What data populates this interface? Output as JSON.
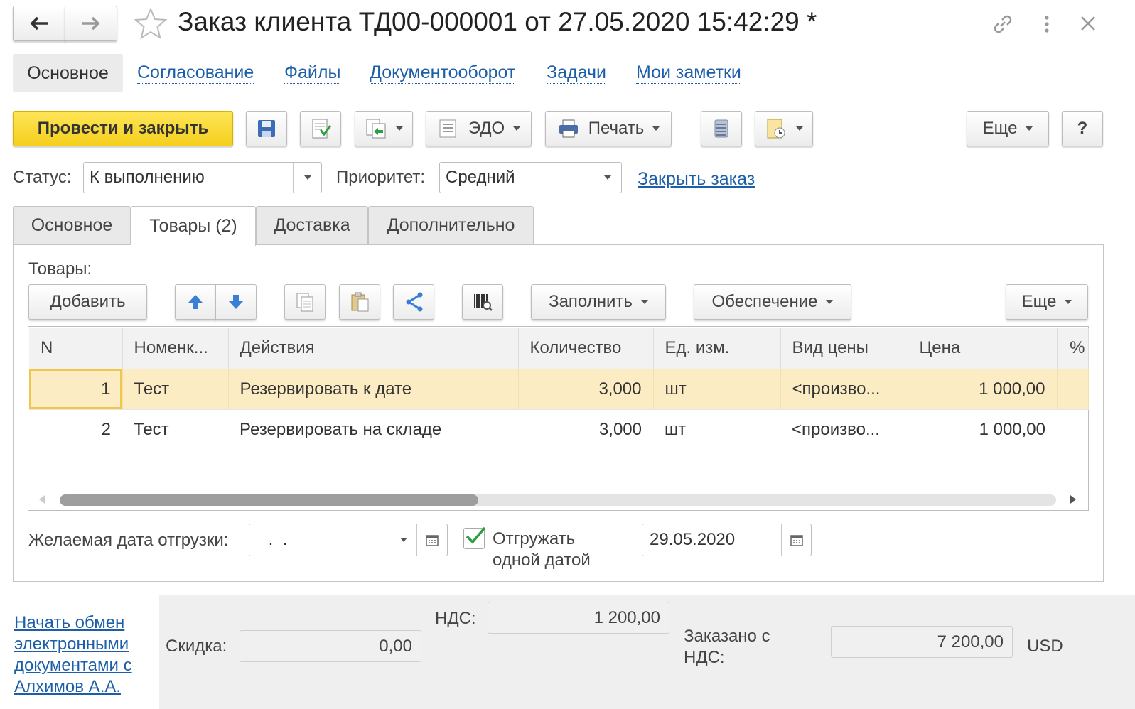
{
  "window": {
    "title": "Заказ клиента ТД00-000001 от 27.05.2020 15:42:29 *"
  },
  "nav": {
    "items": [
      {
        "label": "Основное"
      },
      {
        "label": "Согласование"
      },
      {
        "label": "Файлы"
      },
      {
        "label": "Документооборот"
      },
      {
        "label": "Задачи"
      },
      {
        "label": "Мои заметки"
      }
    ]
  },
  "toolbar": {
    "post_close": "Провести и закрыть",
    "edo": "ЭДО",
    "print": "Печать",
    "more": "Еще",
    "help": "?"
  },
  "status": {
    "status_label": "Статус:",
    "status_value": "К выполнению",
    "priority_label": "Приоритет:",
    "priority_value": "Средний",
    "close_order": "Закрыть заказ"
  },
  "tabs": [
    {
      "label": "Основное"
    },
    {
      "label": "Товары (2)"
    },
    {
      "label": "Доставка"
    },
    {
      "label": "Дополнительно"
    }
  ],
  "goods": {
    "caption": "Товары:",
    "add": "Добавить",
    "fill": "Заполнить",
    "supply": "Обеспечение",
    "more": "Еще",
    "columns": [
      "N",
      "Номенк...",
      "Действия",
      "Количество",
      "Ед. изм.",
      "Вид цены",
      "Цена",
      "%"
    ],
    "rows": [
      {
        "n": "1",
        "item": "Тест",
        "action": "Резервировать к дате",
        "qty": "3,000",
        "unit": "шт",
        "price_type": "<произво...",
        "price": "1 000,00"
      },
      {
        "n": "2",
        "item": "Тест",
        "action": "Резервировать на складе",
        "qty": "3,000",
        "unit": "шт",
        "price_type": "<произво...",
        "price": "1 000,00"
      }
    ],
    "scroll_position": 0.42
  },
  "shipping": {
    "desired_date_label": "Желаемая дата отгрузки:",
    "desired_date_value": " .  .",
    "ship_one_date_line1": "Отгружать",
    "ship_one_date_line2": "одной датой",
    "ship_one_date_checked": true,
    "date_value": "29.05.2020"
  },
  "footer": {
    "edo_link_lines": [
      "Начать обмен",
      "электронными",
      "документами с",
      "Алхимов А.А."
    ],
    "discount_label": "Скидка:",
    "discount_value": "0,00",
    "vat_label": "НДС:",
    "vat_value": "1 200,00",
    "ordered_label_line1": "Заказано с",
    "ordered_label_line2": "НДС:",
    "ordered_value": "7 200,00",
    "currency": "USD"
  },
  "colors": {
    "primary_button": "#f9d92f",
    "link": "#1c5fa8",
    "selected_row": "#fbecc4",
    "check": "#2e9e3f"
  }
}
